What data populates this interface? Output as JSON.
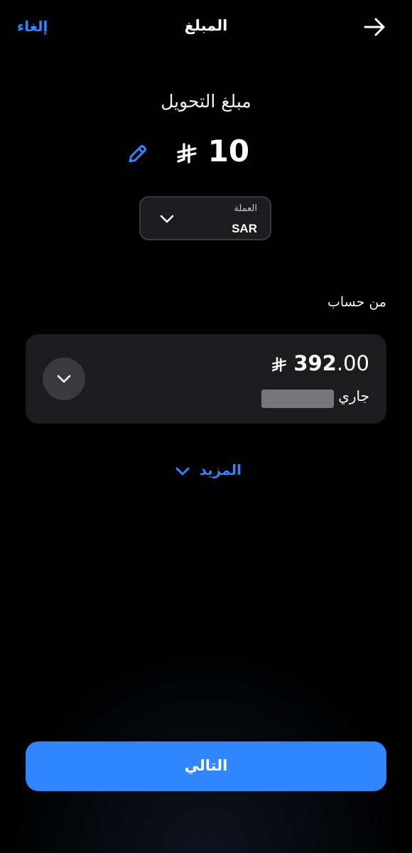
{
  "header": {
    "title": "المبلغ",
    "cancel_label": "إلغاء",
    "back_icon": "arrow-right-icon"
  },
  "amount": {
    "label": "مبلغ التحويل",
    "value": "10",
    "currency_symbol_icon": "saudi-riyal-icon",
    "edit_icon": "pencil-icon"
  },
  "currency": {
    "label": "العملة",
    "value": "SAR",
    "chevron_icon": "chevron-down-icon"
  },
  "from_account": {
    "label": "من حساب",
    "balance_int": "392",
    "balance_dec": ".00",
    "type": "جاري",
    "expand_icon": "chevron-down-icon"
  },
  "more": {
    "label": "المزيد",
    "chevron_icon": "chevron-down-icon"
  },
  "next_button": {
    "label": "التالي"
  },
  "colors": {
    "background": "#000000",
    "accent": "#2f86ff",
    "card": "#1c1c1e",
    "card_border": "#3a3a3c",
    "text": "#ffffff"
  }
}
